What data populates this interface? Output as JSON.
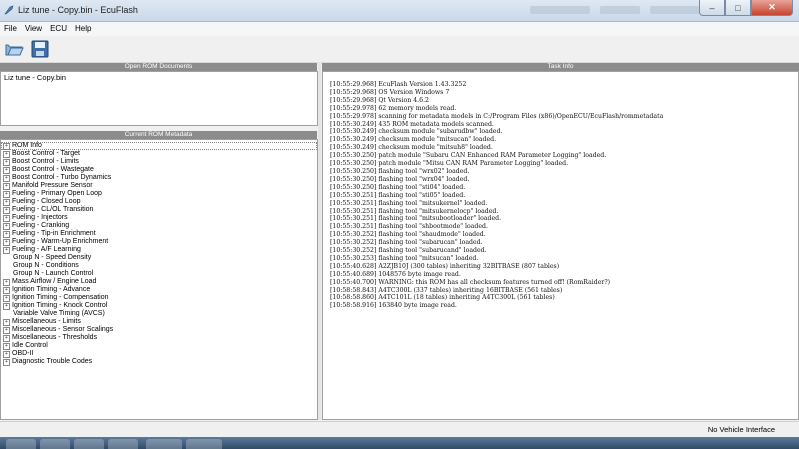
{
  "window": {
    "title": "Liz tune - Copy.bin - EcuFlash"
  },
  "menu": [
    "File",
    "View",
    "ECU",
    "Help"
  ],
  "toolbar": {
    "open_icon": "folder-open-icon",
    "save_icon": "floppy-save-icon"
  },
  "open_rom": {
    "header": "Open ROM Documents",
    "items": [
      "Liz tune - Copy.bin"
    ]
  },
  "metadata": {
    "header": "Current ROM Metadata",
    "items": [
      {
        "label": "ROM Info",
        "expand": true,
        "selected": true
      },
      {
        "label": "Boost Control - Target",
        "expand": true
      },
      {
        "label": "Boost Control - Limits",
        "expand": true
      },
      {
        "label": "Boost Control - Wastegate",
        "expand": true
      },
      {
        "label": "Boost Control - Turbo Dynamics",
        "expand": true
      },
      {
        "label": "Manifold Pressure Sensor",
        "expand": true
      },
      {
        "label": "Fueling - Primary Open Loop",
        "expand": true
      },
      {
        "label": "Fueling - Closed Loop",
        "expand": true
      },
      {
        "label": "Fueling - CL/OL Transition",
        "expand": true
      },
      {
        "label": "Fueling - Injectors",
        "expand": true
      },
      {
        "label": "Fueling - Cranking",
        "expand": true
      },
      {
        "label": "Fueling - Tip-in Enrichment",
        "expand": true
      },
      {
        "label": "Fueling - Warm-Up Enrichment",
        "expand": true
      },
      {
        "label": "Fueling - A/F Learning",
        "expand": true
      },
      {
        "label": "Group N - Speed Density",
        "expand": false
      },
      {
        "label": "Group N - Conditions",
        "expand": false
      },
      {
        "label": "Group N - Launch Control",
        "expand": false
      },
      {
        "label": "Mass Airflow / Engine Load",
        "expand": true
      },
      {
        "label": "Ignition Timing - Advance",
        "expand": true
      },
      {
        "label": "Ignition Timing - Compensation",
        "expand": true
      },
      {
        "label": "Ignition Timing - Knock Control",
        "expand": true
      },
      {
        "label": "Variable Valve Timing (AVCS)",
        "expand": false
      },
      {
        "label": "Miscellaneous - Limits",
        "expand": true
      },
      {
        "label": "Miscellaneous - Sensor Scalings",
        "expand": true
      },
      {
        "label": "Miscellaneous - Thresholds",
        "expand": true
      },
      {
        "label": "Idle Control",
        "expand": true
      },
      {
        "label": "OBD-II",
        "expand": true
      },
      {
        "label": "Diagnostic Trouble Codes",
        "expand": true
      }
    ]
  },
  "task_info": {
    "header": "Task Info",
    "lines": [
      "[10:55:29.968] EcuFlash Version 1.43.3252",
      "[10:55:29.968] OS Version Windows 7",
      "[10:55:29.968] Qt Version 4.6.2",
      "[10:55:29.978] 62 memory models read.",
      "[10:55:29.978] scanning for metadata models in C:/Program Files (x86)/OpenECU/EcuFlash/rommetadata",
      "[10:55:30.249] 435 ROM metadata models scanned.",
      "[10:55:30.249] checksum module \"subarudbw\" loaded.",
      "[10:55:30.249] checksum module \"mitsucan\" loaded.",
      "[10:55:30.249] checksum module \"mitsuh8\" loaded.",
      "[10:55:30.250] patch module \"Subaru CAN Enhanced RAM Parameter Logging\" loaded.",
      "[10:55:30.250] patch module \"Mitsu CAN RAM Parameter Logging\" loaded.",
      "[10:55:30.250] flashing tool \"wrx02\" loaded.",
      "[10:55:30.250] flashing tool \"wrx04\" loaded.",
      "[10:55:30.250] flashing tool \"sti04\" loaded.",
      "[10:55:30.251] flashing tool \"sti05\" loaded.",
      "[10:55:30.251] flashing tool \"mitsukernel\" loaded.",
      "[10:55:30.251] flashing tool \"mitsukernelocp\" loaded.",
      "[10:55:30.251] flashing tool \"mitsubootloader\" loaded.",
      "[10:55:30.251] flashing tool \"shbootmode\" loaded.",
      "[10:55:30.252] flashing tool \"shaudmode\" loaded.",
      "[10:55:30.252] flashing tool \"subarucan\" loaded.",
      "[10:55:30.252] flashing tool \"subarucand\" loaded.",
      "[10:55:30.253] flashing tool \"mitsucan\" loaded.",
      "[10:55:40.628] A2ZJB10J (300 tables) inheriting 32BITBASE (807 tables)",
      "[10:55:40.689] 1048576 byte image read.",
      "[10:55:40.700] WARNING: this ROM has all checksum features turned off! (RomRaider?)",
      "[10:58:58.843] A4TC300L (337 tables) inheriting 16BITBASE (561 tables)",
      "[10:58:58.860] A4TC101L (18 tables) inheriting A4TC300L (561 tables)",
      "[10:58:58.916] 163840 byte image read."
    ]
  },
  "status": {
    "text": "No Vehicle Interface"
  },
  "colors": {
    "panel_header": "#8c8c8c",
    "titlebar": "#c9d8ea",
    "close_button": "#c7442f"
  }
}
